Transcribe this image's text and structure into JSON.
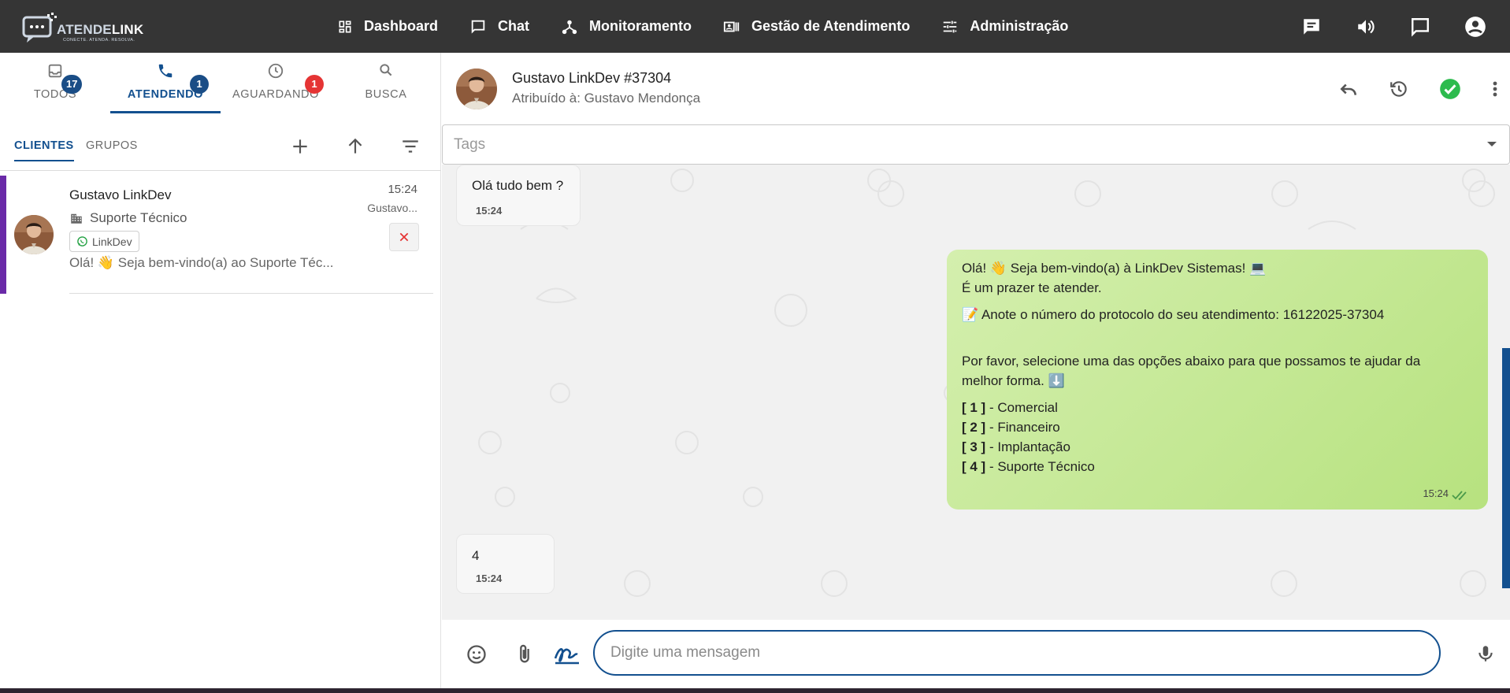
{
  "brand": {
    "logo_main_a": "ATENDE",
    "logo_main_b": "LINK",
    "logo_tagline": "CONECTE. ATENDA. RESOLVA."
  },
  "nav": [
    {
      "label": "Dashboard",
      "icon": "dashboard-icon"
    },
    {
      "label": "Chat",
      "icon": "chat-bubble-icon"
    },
    {
      "label": "Monitoramento",
      "icon": "hub-icon"
    },
    {
      "label": "Gestão de Atendimento",
      "icon": "queue-management-icon"
    },
    {
      "label": "Administração",
      "icon": "tune-icon"
    }
  ],
  "top_actions": [
    "messages-icon",
    "volume-icon",
    "feedback-icon",
    "account-icon"
  ],
  "tabs": [
    {
      "label": "TODOS",
      "badge": "17",
      "icon": "inbox-icon"
    },
    {
      "label": "ATENDENDO",
      "badge": "1",
      "icon": "phone-icon",
      "active": true
    },
    {
      "label": "AGUARDANDO",
      "badge": "1",
      "icon": "clock-icon"
    },
    {
      "label": "BUSCA",
      "icon": "search-icon"
    }
  ],
  "subtabs": {
    "clients": "CLIENTES",
    "groups": "GRUPOS"
  },
  "ticket": {
    "name": "Gustavo LinkDev",
    "queue": "Suporte Técnico",
    "channel": "LinkDev",
    "preview": "Olá! 👋 Seja bem-vindo(a) ao Suporte Téc...",
    "time": "15:24",
    "assignee": "Gustavo...",
    "accent_color": "#6a2aa8"
  },
  "chat": {
    "title": "Gustavo LinkDev #37304",
    "assigned": "Atribuído à: Gustavo Mendonça",
    "tags_placeholder": "Tags",
    "messages": [
      {
        "from": "contact",
        "text": "Olá tudo bem ?",
        "time": "15:24"
      },
      {
        "from": "agent",
        "lines": [
          "Olá! 👋 Seja bem-vindo(a) à LinkDev Sistemas! 💻",
          "É um prazer te atender.",
          "📝 Anote o número do protocolo do seu atendimento: 16122025-37304",
          "Por favor, selecione uma das opções abaixo para que possamos te ajudar da",
          "melhor forma. ⬇️"
        ],
        "options": [
          {
            "key": "[ 1 ]",
            "label": " - Comercial"
          },
          {
            "key": "[ 2 ]",
            "label": " - Financeiro"
          },
          {
            "key": "[ 3 ]",
            "label": " - Implantação"
          },
          {
            "key": "[ 4 ]",
            "label": " - Suporte Técnico"
          }
        ],
        "time": "15:24"
      },
      {
        "from": "contact",
        "text": "4",
        "time": "15:24"
      }
    ],
    "composer_placeholder": "Digite uma mensagem"
  },
  "colors": {
    "primary": "#13508f",
    "topbar": "#353535",
    "out_bubble": "#c3e895",
    "success": "#2dbb4e",
    "danger": "#e53434"
  }
}
